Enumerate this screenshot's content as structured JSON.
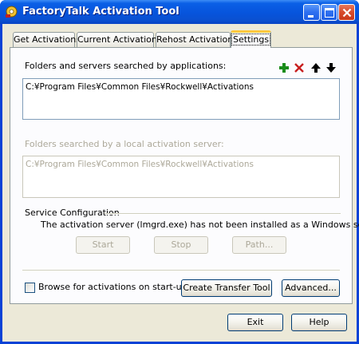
{
  "window": {
    "title": "FactoryTalk Activation Tool"
  },
  "titlebar_buttons": [
    "minimize",
    "maximize",
    "close"
  ],
  "tabs": [
    {
      "label": "Get Activations",
      "active": false
    },
    {
      "label": "Current Activations",
      "active": false
    },
    {
      "label": "Rehost Activations",
      "active": false
    },
    {
      "label": "Settings",
      "active": true
    }
  ],
  "settings": {
    "app_folders_label": "Folders and servers searched by applications:",
    "app_folders": [
      "C:¥Program Files¥Common Files¥Rockwell¥Activations"
    ],
    "toolbar_icons": [
      "add-icon",
      "delete-icon",
      "move-up-icon",
      "move-down-icon"
    ],
    "server_folders_label": "Folders searched by a local activation server:",
    "server_folders": [
      "C:¥Program Files¥Common Files¥Rockwell¥Activations"
    ],
    "service_section_label": "Service Configuration",
    "service_message": "The activation server (lmgrd.exe) has not been installed as a Windows service.",
    "start_label": "Start",
    "stop_label": "Stop",
    "path_label": "Path...",
    "browse_checkbox_label": "Browse for activations on start-up",
    "browse_checked": false,
    "create_transfer_label": "Create Transfer Tool",
    "advanced_label": "Advanced..."
  },
  "footer": {
    "exit_label": "Exit",
    "help_label": "Help"
  },
  "colors": {
    "titlebar": "#0754dc",
    "client": "#ece9d8",
    "active_tab_accent": "#ffc83c",
    "add_icon": "#1a8c1a",
    "delete_icon": "#c81e1e"
  }
}
